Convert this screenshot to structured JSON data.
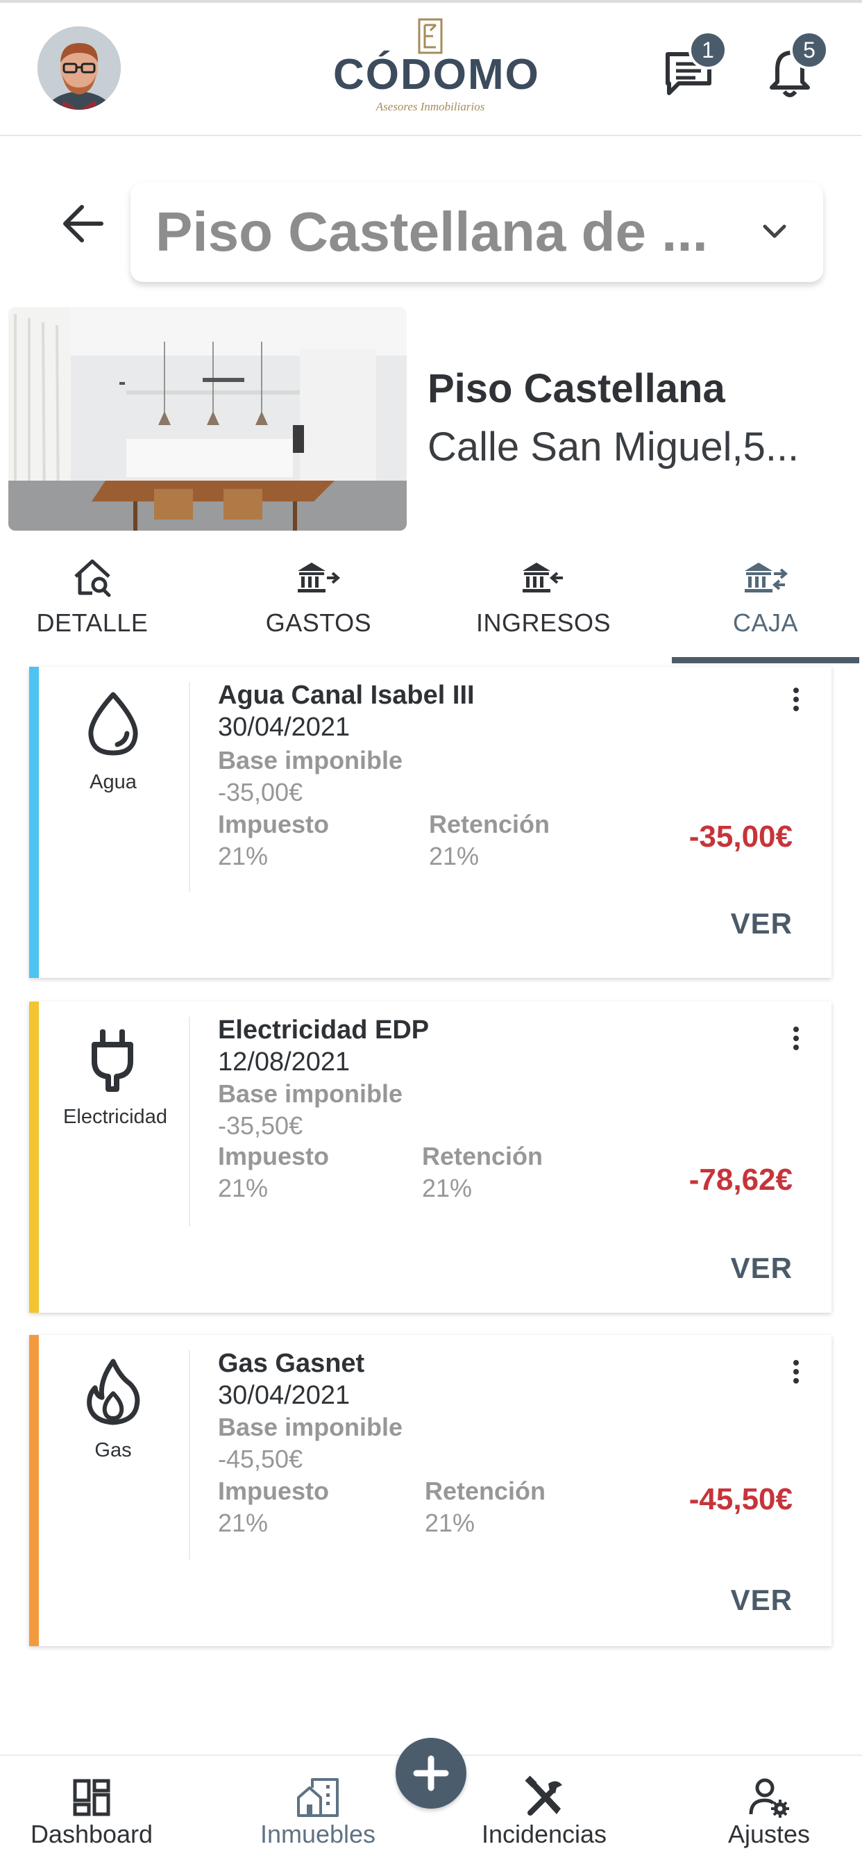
{
  "header": {
    "logo_name": "CÓDOMO",
    "logo_sub": "Asesores Inmobiliarios",
    "messages_badge": "1",
    "notifications_badge": "5"
  },
  "property_selector": {
    "selected": "Piso Castellana de ..."
  },
  "property": {
    "name": "Piso Castellana",
    "address": "Calle San Miguel,5..."
  },
  "tabs": [
    {
      "label": "DETALLE",
      "icon": "house-search-icon"
    },
    {
      "label": "GASTOS",
      "icon": "bank-out-icon"
    },
    {
      "label": "INGRESOS",
      "icon": "bank-in-icon"
    },
    {
      "label": "CAJA",
      "icon": "bank-exchange-icon",
      "active": true
    }
  ],
  "transactions": [
    {
      "category": "Agua",
      "icon": "water-drop-icon",
      "color": "#4cc3f0",
      "title": "Agua Canal Isabel III",
      "date": "30/04/2021",
      "base_label": "Base imponible",
      "base_value": "-35,00€",
      "tax_label": "Impuesto",
      "tax_value": "21%",
      "retention_label": "Retención",
      "retention_value": "21%",
      "amount": "-35,00€",
      "action": "VER"
    },
    {
      "category": "Electricidad",
      "icon": "plug-icon",
      "color": "#f2c530",
      "title": "Electricidad EDP",
      "date": "12/08/2021",
      "base_label": "Base imponible",
      "base_value": "-35,50€",
      "tax_label": "Impuesto",
      "tax_value": "21%",
      "retention_label": "Retención",
      "retention_value": "21%",
      "amount": "-78,62€",
      "action": "VER"
    },
    {
      "category": "Gas",
      "icon": "flame-icon",
      "color": "#f39a3f",
      "title": "Gas Gasnet",
      "date": "30/04/2021",
      "base_label": "Base imponible",
      "base_value": "-45,50€",
      "tax_label": "Impuesto",
      "tax_value": "21%",
      "retention_label": "Retención",
      "retention_value": "21%",
      "amount": "-45,50€",
      "action": "VER"
    }
  ],
  "bottom_nav": [
    {
      "label": "Dashboard",
      "icon": "dashboard-icon"
    },
    {
      "label": "Inmuebles",
      "icon": "buildings-icon",
      "active": true
    },
    {
      "label": "Incidencias",
      "icon": "tools-icon"
    },
    {
      "label": "Ajustes",
      "icon": "user-settings-icon"
    }
  ],
  "fab": {
    "icon": "plus-icon"
  },
  "colors": {
    "primary": "#4b5d6d",
    "amount_negative": "#c6343a",
    "muted_text": "#979797"
  }
}
